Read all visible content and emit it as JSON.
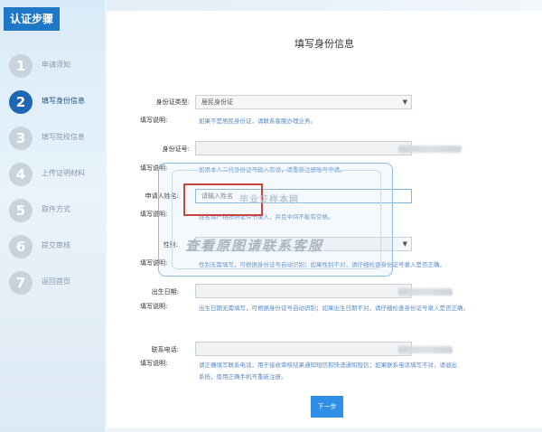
{
  "sidebar": {
    "header": "认证步骤",
    "steps": [
      {
        "num": "1",
        "label": "申请须知"
      },
      {
        "num": "2",
        "label": "填写身份信息"
      },
      {
        "num": "3",
        "label": "填写院校信息"
      },
      {
        "num": "4",
        "label": "上传证明材料"
      },
      {
        "num": "5",
        "label": "取件方式"
      },
      {
        "num": "6",
        "label": "提交审核"
      },
      {
        "num": "7",
        "label": "返回首页"
      }
    ],
    "active_step": 2
  },
  "page_title": "填写身份信息",
  "form": {
    "id_type": {
      "label": "身份证类型:",
      "value": "居民身份证"
    },
    "id_type_note": {
      "label": "填写说明:",
      "text": "如果不是居民身份证，请联系客服办理业务。"
    },
    "id_number": {
      "label": "身份证号:"
    },
    "id_number_note": {
      "label": "填写说明:",
      "text": "如果本人二代身份证号输入有误，请重新注册账号申请。"
    },
    "applicant_name": {
      "label": "申请人姓名:",
      "placeholder": "请输入姓名"
    },
    "applicant_name_note": {
      "label": "填写说明:",
      "text": "姓名请严格按照证件书录入，并且中间不能有空格。"
    },
    "gender": {
      "label": "性别:"
    },
    "gender_note": {
      "label": "填写说明:",
      "text": "性别无需填写，可根据身份证号自动识别；如果性别不对，请仔细检查身份证号录入是否正确。"
    },
    "birth_date": {
      "label": "出生日期:"
    },
    "birth_date_note": {
      "label": "填写说明:",
      "text": "出生日期无需填写，可根据身份证号自动识别；如果出生日期不对，请仔细检查身份证号录入是否正确。"
    },
    "phone": {
      "label": "联系电话:"
    },
    "phone_note": {
      "label": "填写说明:",
      "line1": "请正确填写联系电话，用于接收审核结果通知短信和快递通知短信；如果联系电话填写不对，请退出",
      "line2": "系统，使用正确手机号重新注册。"
    },
    "next_button": "下一步"
  },
  "watermark": {
    "line1": "毕业证样本网",
    "line2": "查看原图请联系客服"
  },
  "colors": {
    "accent": "#1f78c6",
    "note_text": "#5b8ac5",
    "highlight_red": "#c9453a",
    "button": "#2f8fe8"
  }
}
